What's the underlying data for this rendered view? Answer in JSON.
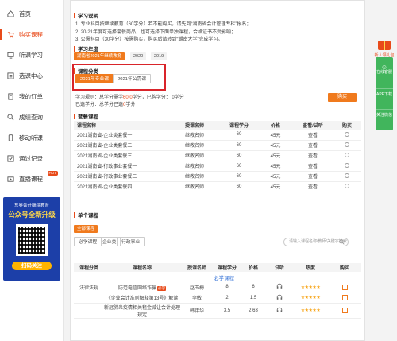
{
  "sidebar": {
    "items": [
      {
        "label": "首页",
        "icon": "home-icon"
      },
      {
        "label": "购买课程",
        "icon": "cart-icon",
        "active": true
      },
      {
        "label": "听课学习",
        "icon": "monitor-icon"
      },
      {
        "label": "选课中心",
        "icon": "courses-icon"
      },
      {
        "label": "我的订单",
        "icon": "order-icon"
      },
      {
        "label": "成绩查询",
        "icon": "search-icon"
      },
      {
        "label": "移动听课",
        "icon": "mobile-icon"
      },
      {
        "label": "通过记录",
        "icon": "record-icon"
      },
      {
        "label": "直播课程",
        "icon": "live-icon",
        "badge": "HOT"
      }
    ],
    "promo": {
      "title": "东奥会计继续教育",
      "slogan": "公众号全新升级",
      "button": "扫码关注"
    }
  },
  "study_info": {
    "title": "学习说明",
    "notes": [
      "1. 专业科目按继续教育（60学分）若不能购买，请先到“湖南省会计管理专栏”报名；",
      "2. 20-21年度可选择套餐商品，也可选择下面单独课程，合格证书不受影响；",
      "3. 公需科目（30学分）按需购买，购买后请转到“湖南大学”完成学习。"
    ]
  },
  "year": {
    "title": "学习年度",
    "options": [
      "湖南省2021年继续教育",
      "2020",
      "2019"
    ],
    "selected": 0
  },
  "category": {
    "title": "课程分类",
    "options": [
      "2021年专业课",
      "2021年公需课"
    ],
    "selected": 0
  },
  "stats": {
    "line1_prefix": "学习规则：总学分需学",
    "line1_value": "60.0",
    "line1_suffix": "学分，已购学分：",
    "line1_bought": "0学分",
    "line2_prefix": "已选学分：总学分已选",
    "line2_value": "0",
    "line2_suffix": "学分"
  },
  "buy_button": "购买",
  "packages": {
    "title": "套餐课程",
    "columns": [
      "课程名称",
      "授课名师",
      "课程学分",
      "价格",
      "查看/试听",
      "购买"
    ],
    "rows": [
      {
        "name": "2021湖南省-企业类套餐一",
        "teacher": "继教名师",
        "credit": "60",
        "price": "45元",
        "view": "查看"
      },
      {
        "name": "2021湖南省-企业类套餐二",
        "teacher": "继教名师",
        "credit": "60",
        "price": "45元",
        "view": "查看"
      },
      {
        "name": "2021湖南省-企业类套餐三",
        "teacher": "继教名师",
        "credit": "60",
        "price": "45元",
        "view": "查看"
      },
      {
        "name": "2021湖南省-行政事业套餐一",
        "teacher": "继教名师",
        "credit": "60",
        "price": "45元",
        "view": "查看"
      },
      {
        "name": "2021湖南省-行政事业套餐二",
        "teacher": "继教名师",
        "credit": "60",
        "price": "45元",
        "view": "查看"
      },
      {
        "name": "2021湖南省-企业类套餐四",
        "teacher": "继教名师",
        "credit": "60",
        "price": "45元",
        "view": "查看"
      }
    ]
  },
  "single": {
    "title": "单个课程",
    "all_label": "全部课程",
    "filters": [
      "必学课程",
      "企业类",
      "行政事业"
    ],
    "search_placeholder": "请输入课程名称/教师/关键字搜索",
    "columns": [
      "课程分类",
      "课程名称",
      "授课名师",
      "课程学分",
      "价格",
      "试听",
      "热度",
      "购买"
    ],
    "group_label": "必学课程",
    "rows": [
      {
        "cat": "法律法规",
        "name": "防范电信网络诈骗",
        "tag": "必学",
        "teacher": "赵玉梅",
        "credit": "8",
        "price": "6",
        "stars": "★★★★★"
      },
      {
        "cat": "",
        "name": "《企业会计准则解释第13号》解读",
        "tag": "",
        "teacher": "李敏",
        "credit": "2",
        "price": "1.5",
        "stars": "★★★★★"
      },
      {
        "cat": "",
        "name": "新冠肺炎疫情相关租金减让会计处理规定",
        "tag": "",
        "teacher": "韩伟华",
        "credit": "3.5",
        "price": "2.63",
        "stars": "★★★★★"
      }
    ]
  },
  "right_widgets": {
    "gift": "新人领礼包",
    "items": [
      "在线客服",
      "APP下载",
      "关注微信"
    ]
  }
}
